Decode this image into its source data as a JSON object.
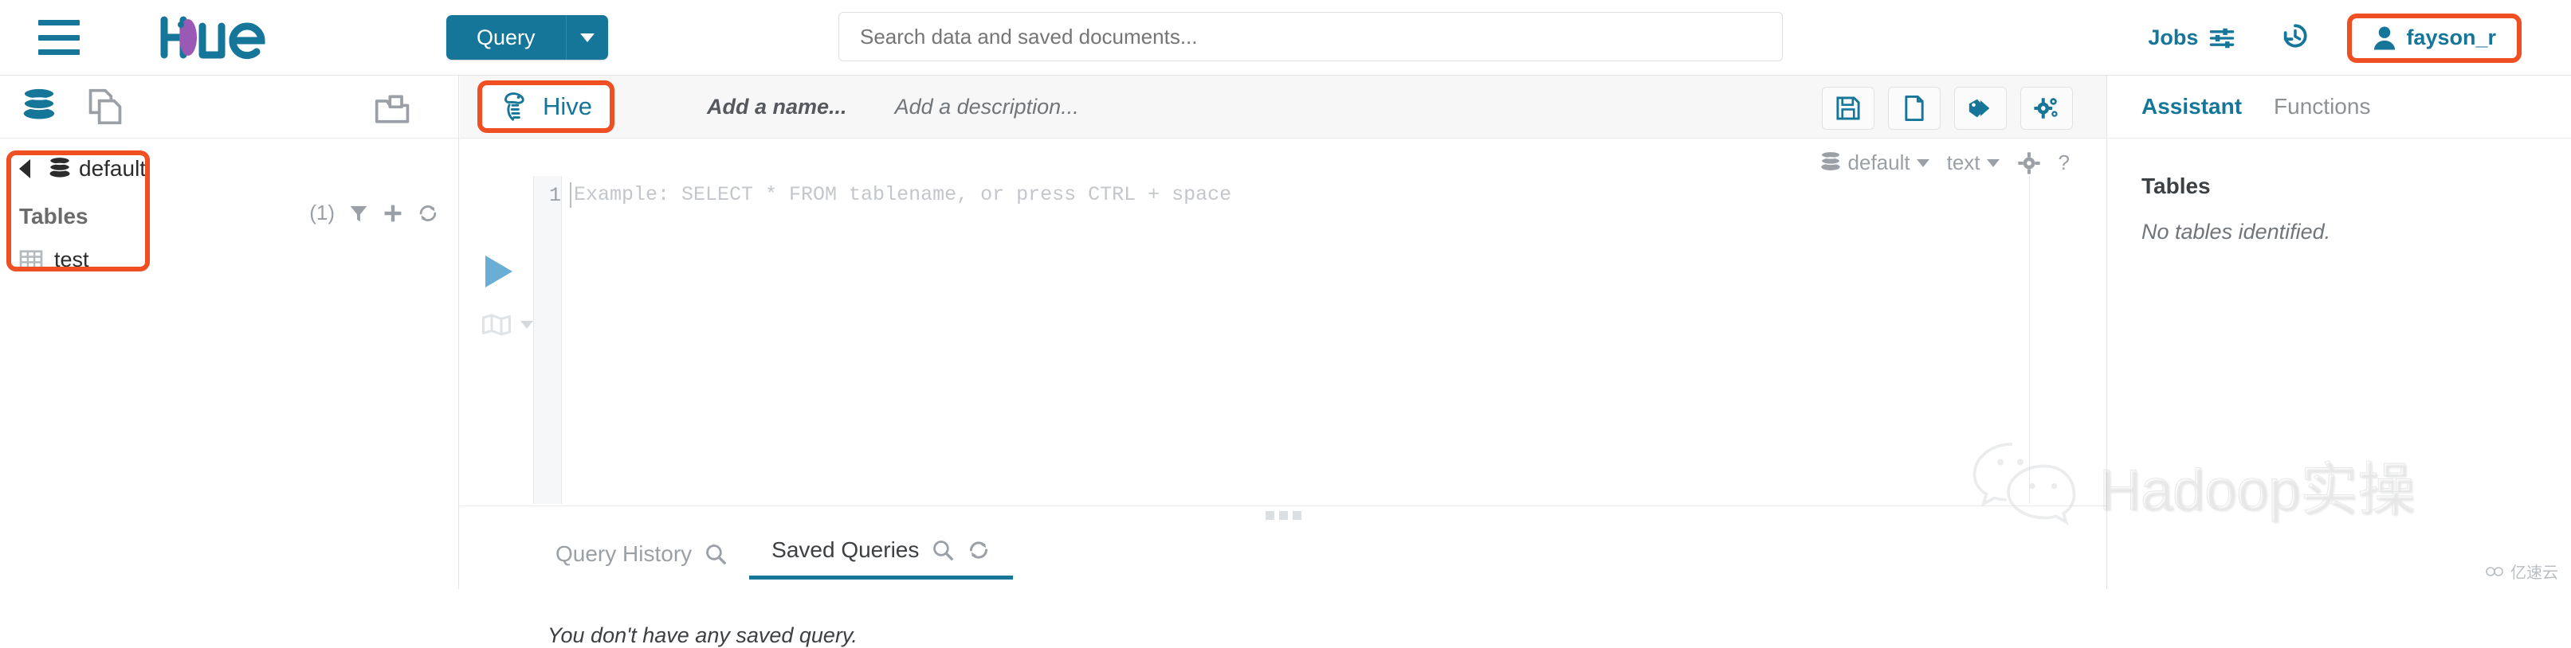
{
  "topnav": {
    "menu_icon": "hamburger-icon",
    "logo_text": "hue",
    "query_button": "Query",
    "query_caret": "chevron-down-icon",
    "search_placeholder": "Search data and saved documents...",
    "search_value": "",
    "jobs_label": "Jobs",
    "jobs_icon": "sliders-icon",
    "history_icon": "history-icon",
    "user_icon": "user-icon",
    "user_name": "fayson_r"
  },
  "left_panel": {
    "header_icons": [
      "database-icon",
      "documents-icon",
      "folder-icon"
    ],
    "back_chevron": "chevron-left-icon",
    "database_name": "default",
    "database_icon": "database-icon",
    "tables_label": "Tables",
    "tables_count": "(1)",
    "action_icons": [
      "filter-icon",
      "plus-icon",
      "refresh-icon"
    ],
    "tables": [
      {
        "name": "test",
        "icon": "table-grid-icon"
      }
    ]
  },
  "center": {
    "tab_label": "Hive",
    "tab_icon": "hive-bee-icon",
    "name_placeholder": "Add a name...",
    "description_placeholder": "Add a description...",
    "toolbar_buttons": [
      {
        "name": "save-button",
        "icon": "floppy-disk-icon"
      },
      {
        "name": "new-document-button",
        "icon": "file-icon"
      },
      {
        "name": "tag-button",
        "icon": "tag-icon"
      },
      {
        "name": "settings-button",
        "icon": "gears-icon"
      }
    ],
    "editor_toolbar": {
      "database": "default",
      "database_icon": "database-icon",
      "format": "text",
      "settings_icon": "gear-icon",
      "help_icon": "question-mark-icon"
    },
    "editor": {
      "line_number": "1",
      "placeholder": "Example: SELECT * FROM tablename, or press CTRL + space",
      "value": ""
    },
    "run_button_icon": "play-icon",
    "layout_button_icon": "layout-icon",
    "bottom_tabs": [
      {
        "label": "Query History",
        "icons": [
          "search-icon"
        ],
        "active": false
      },
      {
        "label": "Saved Queries",
        "icons": [
          "search-icon",
          "refresh-icon"
        ],
        "active": true
      }
    ],
    "empty_message": "You don't have any saved query."
  },
  "right_panel": {
    "tabs": [
      {
        "label": "Assistant",
        "active": true
      },
      {
        "label": "Functions",
        "active": false
      }
    ],
    "section_title": "Tables",
    "empty_message": "No tables identified."
  },
  "watermark": {
    "text": "Hadoop实操",
    "icon": "wechat-icon",
    "corner_text": "亿速云"
  },
  "colors": {
    "brand_blue": "#16769a",
    "highlight_orange": "#f04e23",
    "muted_gray": "#9aa0a6"
  }
}
